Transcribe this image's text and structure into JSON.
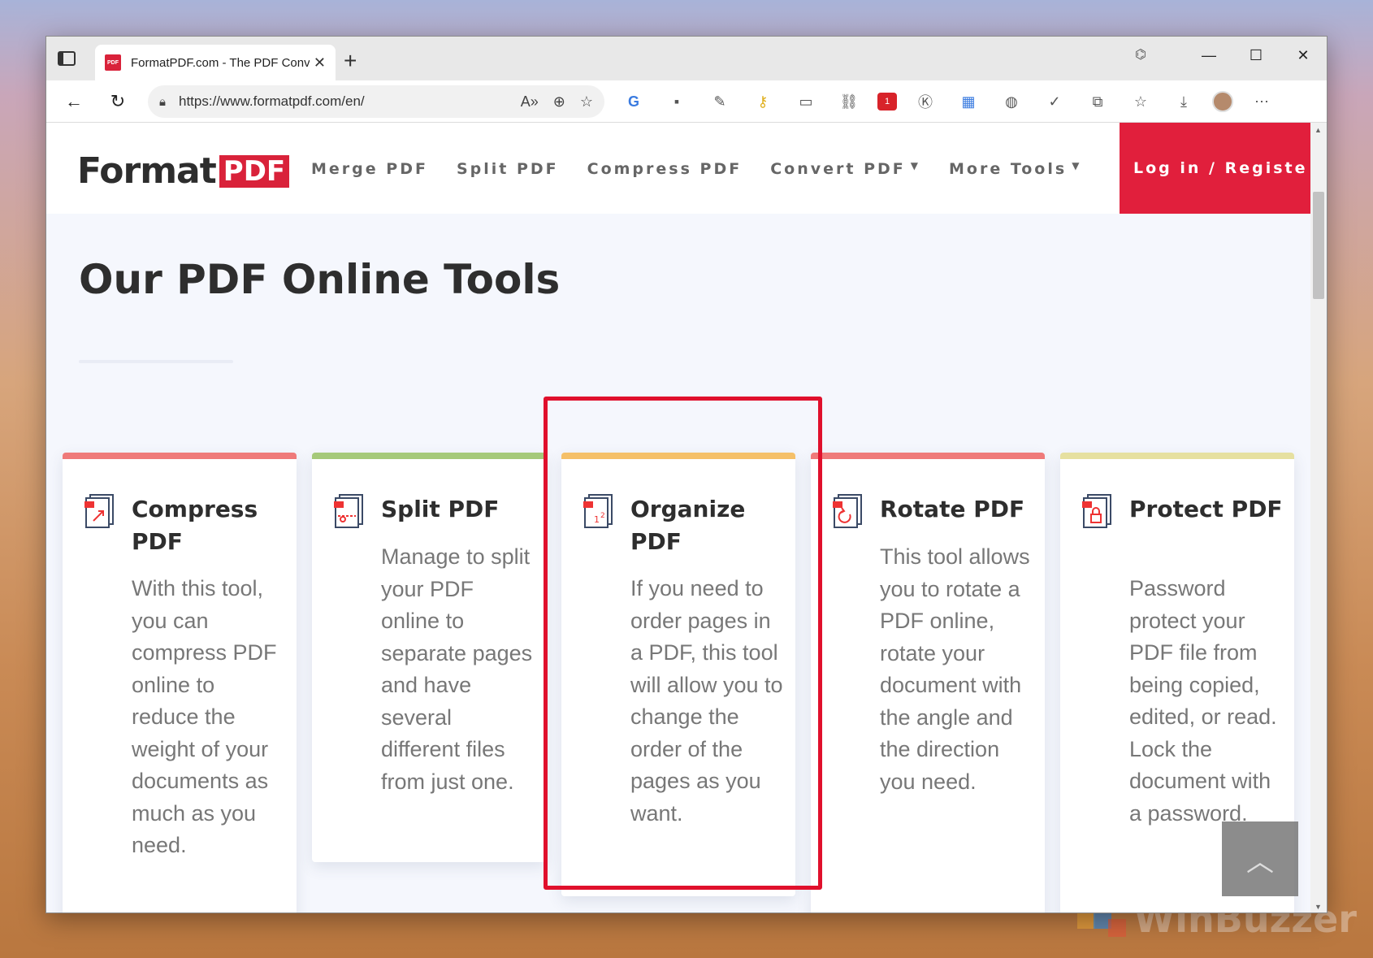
{
  "browser": {
    "tab_title": "FormatPDF.com - The PDF Conve",
    "tab_favicon": "PDF",
    "url": "https://www.formatpdf.com/en/",
    "icons": [
      "back-icon",
      "refresh-icon",
      "lock-icon",
      "read-aloud-icon",
      "zoom-icon",
      "favorite-add-icon",
      "translate-icon",
      "extension-icon",
      "pen-icon",
      "keys-icon",
      "tab-icon",
      "link-icon",
      "badge-extension-icon",
      "k-extension-icon",
      "grid-extension-icon",
      "globe-extension-icon",
      "spellcheck-icon",
      "puzzle-icon",
      "favorites-icon",
      "download-icon",
      "avatar",
      "more-icon"
    ],
    "badge_count": "1"
  },
  "site": {
    "logo_text": "Format",
    "logo_pdf": "PDF",
    "nav": [
      "Merge PDF",
      "Split PDF",
      "Compress PDF",
      "Convert PDF",
      "More Tools"
    ],
    "login": "Log in / Registe",
    "page_title": "Our PDF Online Tools"
  },
  "cards": [
    {
      "title": "Compress PDF",
      "desc": "With this tool, you can compress PDF online to reduce the weight of your documents as much as you need.",
      "accent": "#ef7a7a"
    },
    {
      "title": "Split PDF",
      "desc": "Manage to split your PDF online to separate pages and have several different files from just one.",
      "accent": "#a5c97a"
    },
    {
      "title": "Organize PDF",
      "desc": "If you need to order pages in a PDF, this tool will allow you to change the order of the pages as you want.",
      "accent": "#f5c069"
    },
    {
      "title": "Rotate PDF",
      "desc": "This tool allows you to rotate a PDF online, rotate your document with the angle and the direction you need.",
      "accent": "#ef7a7a"
    },
    {
      "title": "Protect PDF",
      "desc": "Password protect your PDF file from being copied, edited, or read. Lock the document with a password.",
      "accent": "#e6e0a0"
    }
  ],
  "watermark": "WinBuzzer",
  "colors": {
    "brand": "#e11f3c",
    "highlight": "#e0102c"
  }
}
